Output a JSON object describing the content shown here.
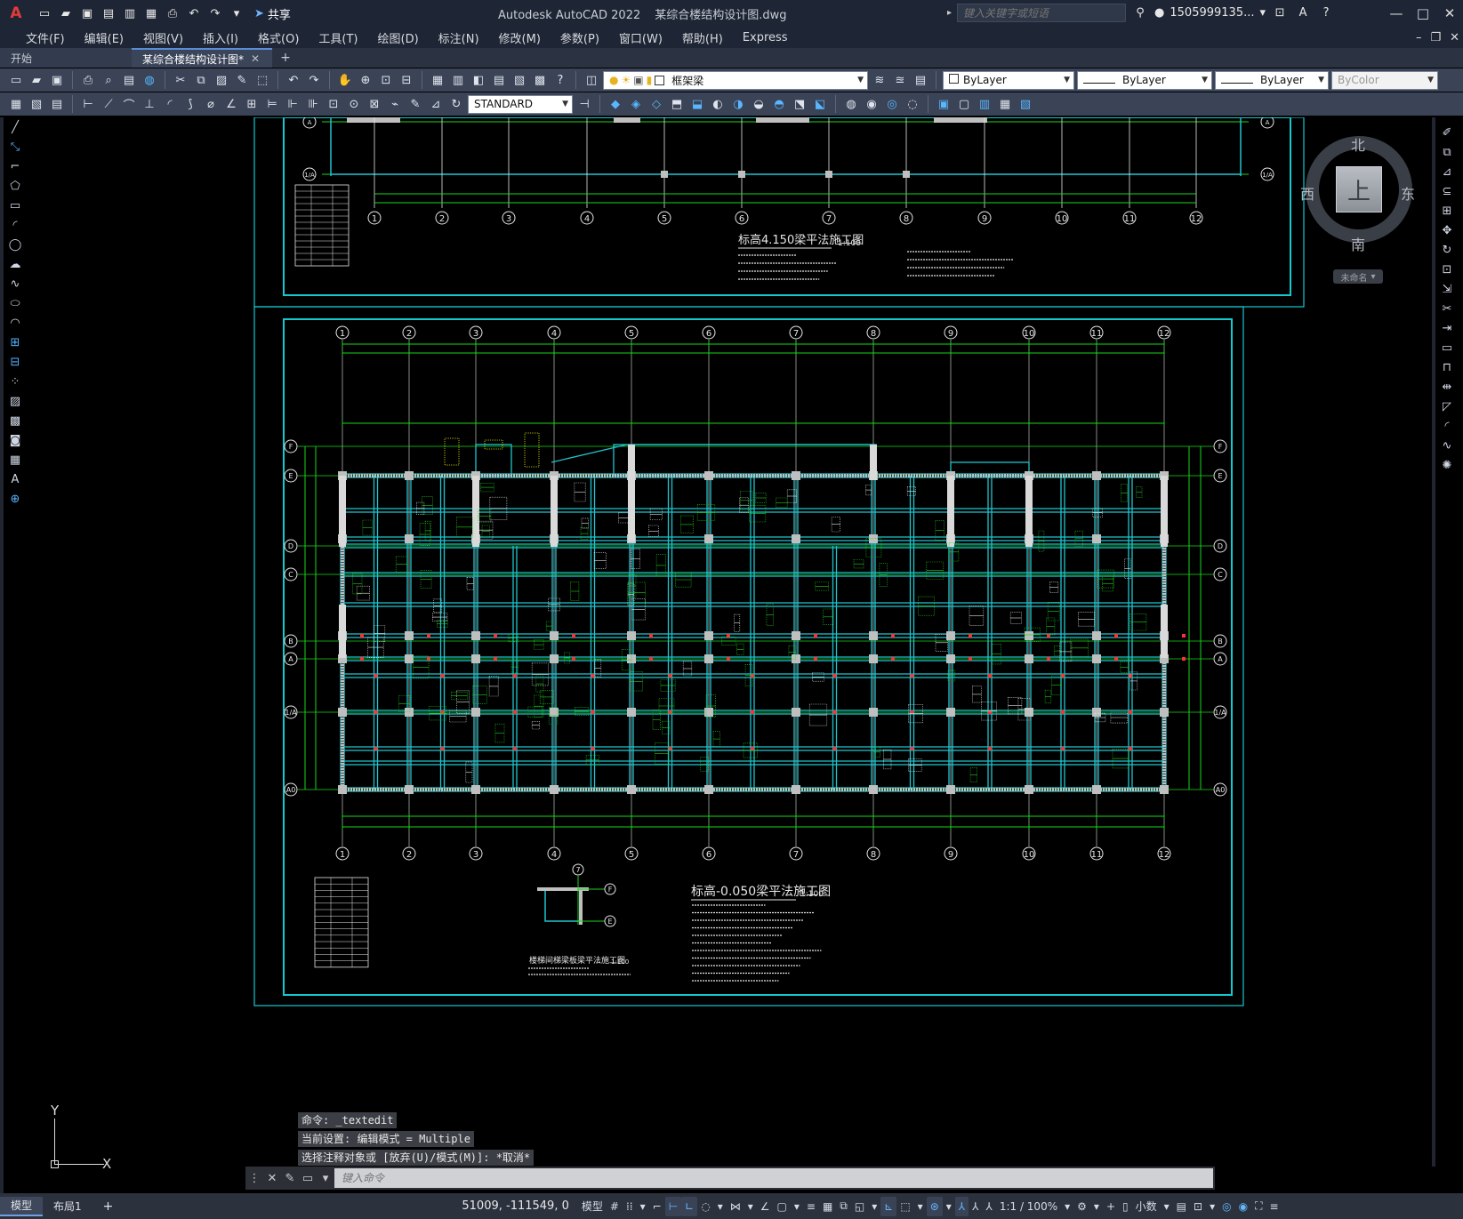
{
  "app": {
    "logo": "A",
    "name": "Autodesk AutoCAD 2022",
    "file": "某综合楼结构设计图.dwg",
    "share_label": "共享",
    "search_placeholder": "键入关键字或短语",
    "user": "1505999135..."
  },
  "menu": [
    "文件(F)",
    "编辑(E)",
    "视图(V)",
    "插入(I)",
    "格式(O)",
    "工具(T)",
    "绘图(D)",
    "标注(N)",
    "修改(M)",
    "参数(P)",
    "窗口(W)",
    "帮助(H)",
    "Express"
  ],
  "tabs": {
    "start": "开始",
    "active": "某综合楼结构设计图*"
  },
  "toolbar": {
    "layer": "框架梁",
    "text_style": "STANDARD",
    "color": "ByLayer",
    "linetype": "ByLayer",
    "lineweight": "ByLayer",
    "plotstyle": "ByColor"
  },
  "viewcube": {
    "north": "北",
    "south": "南",
    "west": "西",
    "east": "东",
    "face": "上",
    "ucs_name": "未命名"
  },
  "ucs": {
    "x": "X",
    "y": "Y"
  },
  "drawing": {
    "axis_numbers": [
      "1",
      "2",
      "3",
      "4",
      "5",
      "6",
      "7",
      "8",
      "9",
      "10",
      "11",
      "12"
    ],
    "axis_letters": [
      "F",
      "E",
      "D",
      "C",
      "B",
      "A",
      "1/A",
      "A0"
    ],
    "upper_title": "标高4.150梁平法施工图",
    "lower_title": "标高-0.050梁平法施工图",
    "scale": "1:100",
    "detail_title": "楼梯间梯梁板梁平法施工图"
  },
  "command": {
    "history": [
      "命令: _textedit",
      "当前设置: 编辑模式 = Multiple",
      "选择注释对象或 [放弃(U)/模式(M)]: *取消*"
    ],
    "placeholder": "键入命令"
  },
  "status": {
    "model_tab": "模型",
    "layout_tab": "布局1",
    "coords": "51009, -111549, 0",
    "model_label": "模型",
    "scale": "1:1 / 100%",
    "units": "小数"
  }
}
